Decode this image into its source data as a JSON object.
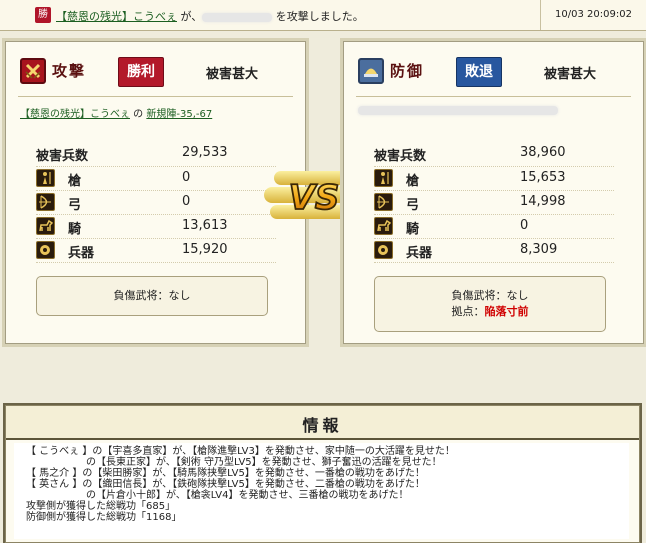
{
  "topbar": {
    "badge": "勝",
    "alliance": "【慈恩の残光】",
    "attacker": "こうべぇ",
    "text_ga": " が、",
    "text_end": " を攻撃しました。",
    "timestamp": "10/03 20:09:02"
  },
  "attack": {
    "role": "攻撃",
    "result": "勝利",
    "damage_level": "被害甚大",
    "alliance": "【慈恩の残光】",
    "player": "こうべぇ",
    "no": " の ",
    "location": "新規陣-35,-67",
    "total_label": "被害兵数",
    "total": "29,533",
    "units": [
      {
        "icon": "spear-icon",
        "label": "槍",
        "value": "0"
      },
      {
        "icon": "bow-icon",
        "label": "弓",
        "value": "0"
      },
      {
        "icon": "horse-icon",
        "label": "騎",
        "value": "13,613"
      },
      {
        "icon": "siege-icon",
        "label": "兵器",
        "value": "15,920"
      }
    ],
    "wounded_label": "負傷武将：",
    "wounded_value": "なし"
  },
  "defense": {
    "role": "防御",
    "result": "敗退",
    "damage_level": "被害甚大",
    "total_label": "被害兵数",
    "total": "38,960",
    "units": [
      {
        "icon": "spear-icon",
        "label": "槍",
        "value": "15,653"
      },
      {
        "icon": "bow-icon",
        "label": "弓",
        "value": "14,998"
      },
      {
        "icon": "horse-icon",
        "label": "騎",
        "value": "0"
      },
      {
        "icon": "siege-icon",
        "label": "兵器",
        "value": "8,309"
      }
    ],
    "wounded_label": "負傷武将：",
    "wounded_value": "なし",
    "base_label": "拠点：",
    "base_value": "陥落寸前"
  },
  "vs_text": "VS",
  "info": {
    "title": "情報",
    "lines": [
      "【 こうべぇ 】の【宇喜多直家】が、【槍隊進撃LV3】を発動させ、家中随一の大活躍を見せた！",
      "　　　　　　の【長東正家】が、【剣術 守乃型LV5】を発動させ、獅子奮迅の活躍を見せた！",
      "【 馬之介 】の【柴田勝家】が、【騎馬隊挟撃LV5】を発動させ、一番槍の戦功をあげた！",
      "【 英さん 】の【織田信長】が、【鉄砲隊挟撃LV5】を発動させ、二番槍の戦功をあげた！",
      "　　　　　　の【片倉小十郎】が、【槍衾LV4】を発動させ、三番槍の戦功をあげた！",
      "攻撃側が獲得した総戦功「685」",
      "防御側が獲得した総戦功「1168」"
    ]
  },
  "colors": {
    "win": "#b3192a",
    "lose": "#28579f",
    "danger": "#d00000",
    "link": "#1b5e20"
  }
}
